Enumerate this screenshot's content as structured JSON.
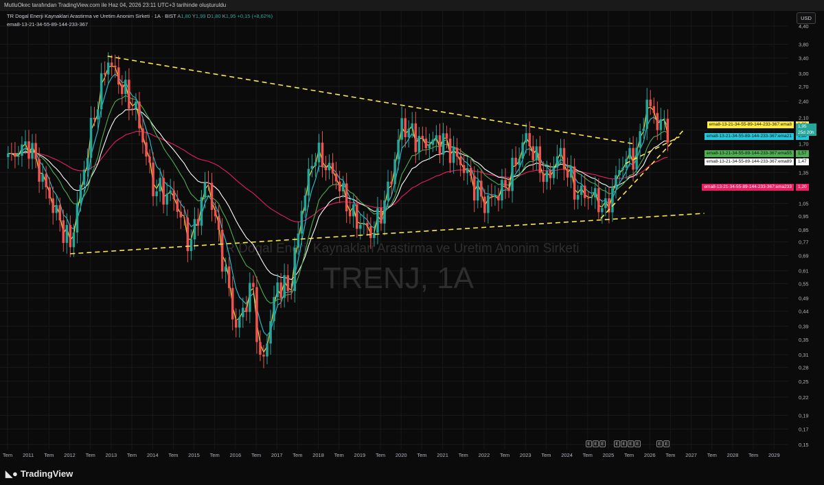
{
  "header": {
    "credit": "MutluOkec tarafından TradingView.com ile Haz 04, 2026 23:11 UTC+3 tarihinde oluşturuldu",
    "symbol_title": "TR Dogal Enerji Kaynaklari Arastirma ve Uretim Anonim Sirketi · 1A · BIST",
    "ohlc": [
      {
        "label": "A",
        "value": "1,80"
      },
      {
        "label": "Y",
        "value": "1,99"
      },
      {
        "label": "D",
        "value": "1,80"
      },
      {
        "label": "K",
        "value": "1,95"
      }
    ],
    "change": "+0,15 (+8,62%)",
    "indicator": "ema8-13-21-34-55-89-144-233-367",
    "currency": "USD"
  },
  "watermark": {
    "ticker": "TRENJ, 1A",
    "name": "TR Dogal Enerji Kaynaklari Arastirma ve Uretim Anonim Sirketi"
  },
  "footer": {
    "logo_text": "TradingView"
  },
  "colors": {
    "up": "#26a69a",
    "down": "#ef5350",
    "ema8": "#ffeb3b",
    "ema21": "#26c6da",
    "ema55": "#4caf50",
    "ema89": "#ffffff",
    "ema233": "#e91e63",
    "trend": "#ffe84a"
  },
  "events": [
    "E",
    "E",
    "E",
    "E",
    "E",
    "E",
    "E",
    "E",
    "E"
  ],
  "chart_data": {
    "type": "candlestick",
    "scale": "log",
    "interval": "1A",
    "y_ticks": [
      "4,40",
      "3,80",
      "3,40",
      "3,00",
      "2,70",
      "2,40",
      "2,10",
      "1,90",
      "1,70",
      "1,50",
      "1,35",
      "1,20",
      "1,05",
      "0,95",
      "0,85",
      "0,77",
      "0,69",
      "0,61",
      "0,55",
      "0,49",
      "0,44",
      "0,39",
      "0,35",
      "0,31",
      "0,28",
      "0,25",
      "0,22",
      "0,19",
      "0,17",
      "0,15"
    ],
    "x_ticks": [
      "Tem",
      "2011",
      "Tem",
      "2012",
      "Tem",
      "2013",
      "Tem",
      "2014",
      "Tem",
      "2015",
      "Tem",
      "2016",
      "Tem",
      "2017",
      "Tem",
      "2018",
      "Tem",
      "2019",
      "Tem",
      "2020",
      "Tem",
      "2021",
      "Tem",
      "2022",
      "Tem",
      "2023",
      "Tem",
      "2024",
      "Tem",
      "2025",
      "Tem",
      "2026",
      "Tem",
      "2027",
      "Tem",
      "2028",
      "Tem",
      "2029"
    ],
    "anchors": [
      {
        "t": 2010.5,
        "p": 1.5
      },
      {
        "t": 2011.0,
        "p": 1.7
      },
      {
        "t": 2011.5,
        "p": 1.1
      },
      {
        "t": 2012.0,
        "p": 0.75
      },
      {
        "t": 2012.5,
        "p": 1.9
      },
      {
        "t": 2012.9,
        "p": 3.4
      },
      {
        "t": 2013.3,
        "p": 2.6
      },
      {
        "t": 2013.6,
        "p": 2.2
      },
      {
        "t": 2014.0,
        "p": 1.2
      },
      {
        "t": 2014.5,
        "p": 1.1
      },
      {
        "t": 2014.9,
        "p": 0.75
      },
      {
        "t": 2015.3,
        "p": 1.3
      },
      {
        "t": 2015.7,
        "p": 0.65
      },
      {
        "t": 2016.0,
        "p": 0.38
      },
      {
        "t": 2016.4,
        "p": 0.55
      },
      {
        "t": 2016.6,
        "p": 0.27
      },
      {
        "t": 2017.0,
        "p": 0.55
      },
      {
        "t": 2017.3,
        "p": 0.52
      },
      {
        "t": 2017.6,
        "p": 1.05
      },
      {
        "t": 2017.9,
        "p": 1.6
      },
      {
        "t": 2018.4,
        "p": 1.3
      },
      {
        "t": 2018.8,
        "p": 0.95
      },
      {
        "t": 2019.3,
        "p": 0.82
      },
      {
        "t": 2019.7,
        "p": 1.2
      },
      {
        "t": 2020.0,
        "p": 2.0
      },
      {
        "t": 2020.5,
        "p": 1.7
      },
      {
        "t": 2021.0,
        "p": 1.75
      },
      {
        "t": 2021.5,
        "p": 1.4
      },
      {
        "t": 2022.0,
        "p": 1.05
      },
      {
        "t": 2022.5,
        "p": 1.2
      },
      {
        "t": 2023.0,
        "p": 1.8
      },
      {
        "t": 2023.5,
        "p": 1.25
      },
      {
        "t": 2023.8,
        "p": 1.6
      },
      {
        "t": 2024.2,
        "p": 1.15
      },
      {
        "t": 2024.7,
        "p": 1.1
      },
      {
        "t": 2024.9,
        "p": 0.98
      },
      {
        "t": 2025.3,
        "p": 1.45
      },
      {
        "t": 2025.7,
        "p": 1.6
      },
      {
        "t": 2025.9,
        "p": 2.4
      },
      {
        "t": 2026.2,
        "p": 2.0
      },
      {
        "t": 2026.42,
        "p": 1.95
      }
    ],
    "ema_end_values": [
      {
        "name": "ema8-13-21-34-55-89-144-233-367:ema8",
        "value": "1,98"
      },
      {
        "name": "ema8-13-21-34-55-89-144-233-367:ema21",
        "value": "1,80"
      },
      {
        "name": "ema8-13-21-34-55-89-144-233-367:ema55",
        "value": "1,57"
      },
      {
        "name": "ema8-13-21-34-55-89-144-233-367:ema89",
        "value": "1,47"
      },
      {
        "name": "ema8-13-21-34-55-89-144-233-367:ema233",
        "value": "1,20"
      }
    ],
    "last_price": {
      "value": "1,95",
      "countdown": "25d 20h"
    },
    "trendlines": [
      {
        "from": {
          "t": 2012.9,
          "p": 3.45
        },
        "to": {
          "t": 2025.6,
          "p": 1.7
        }
      },
      {
        "from": {
          "t": 2012.0,
          "p": 0.7
        },
        "to": {
          "t": 2027.3,
          "p": 0.97
        }
      },
      {
        "from": {
          "t": 2024.8,
          "p": 0.93
        },
        "to": {
          "t": 2026.8,
          "p": 1.9
        }
      },
      {
        "from": {
          "t": 2025.4,
          "p": 1.45
        },
        "to": {
          "t": 2026.7,
          "p": 1.8
        }
      }
    ]
  }
}
